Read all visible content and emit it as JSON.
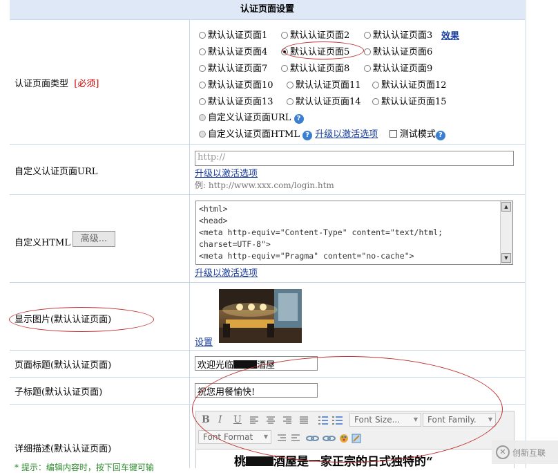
{
  "header": {
    "title": "认证页面设置"
  },
  "type_row": {
    "label": "认证页面类型",
    "required": "[必须]",
    "options": [
      "默认认证页面1",
      "默认认证页面2",
      "默认认证页面3",
      "默认认证页面4",
      "默认认证页面5",
      "默认认证页面6",
      "默认认证页面7",
      "默认认证页面8",
      "默认认证页面9",
      "默认认证页面10",
      "默认认证页面11",
      "默认认证页面12",
      "默认认证页面13",
      "默认认证页面14",
      "默认认证页面15"
    ],
    "selected": "默认认证页面5",
    "effect_link": "效果",
    "custom_url": "自定义认证页面URL",
    "custom_html": "自定义认证页面HTML",
    "upgrade_link": "升级以激活选项",
    "test_mode": "测试模式",
    "help_glyph": "?"
  },
  "url_row": {
    "label": "自定义认证页面URL",
    "placeholder": "http://",
    "upgrade_link": "升级以激活选项",
    "example": "例: http://www.xxx.com/login.htm"
  },
  "html_row": {
    "label": "自定义HTML",
    "advanced_button": "高级...",
    "code": "<html>\n<head>\n<meta http-equiv=\"Content-Type\" content=\"text/html;\ncharset=UTF-8\">\n<meta http-equiv=\"Pragma\" content=\"no-cache\">",
    "upgrade_link": "升级以激活选项"
  },
  "image_row": {
    "label": "显示图片(默认认证页面)",
    "set_link": "设置"
  },
  "title_row": {
    "label": "页面标题(默认认证页面)",
    "value": "欢迎光临",
    "value_tail": "酒屋"
  },
  "subtitle_row": {
    "label": "子标题(默认认证页面)",
    "value": "祝您用餐愉快!"
  },
  "desc_row": {
    "label": "详细描述(默认认证页面)",
    "hint": "* 提示：编辑内容时，按下回车键可输",
    "toolbar": {
      "font_size": "Font Size...",
      "font_family": "Font Family.",
      "font_format": "Font Format",
      "bold": "B",
      "italic": "I",
      "underline": "U"
    },
    "content_head": "桃",
    "content_tail": "酒屋是一家正宗的日式独特的“"
  },
  "watermark": "创新互联",
  "colors": {
    "header_bg": "#dfe8f6",
    "border": "#c6d6e8",
    "link": "#1a3e9e",
    "required": "#cc0000",
    "annotation": "#c03030"
  }
}
